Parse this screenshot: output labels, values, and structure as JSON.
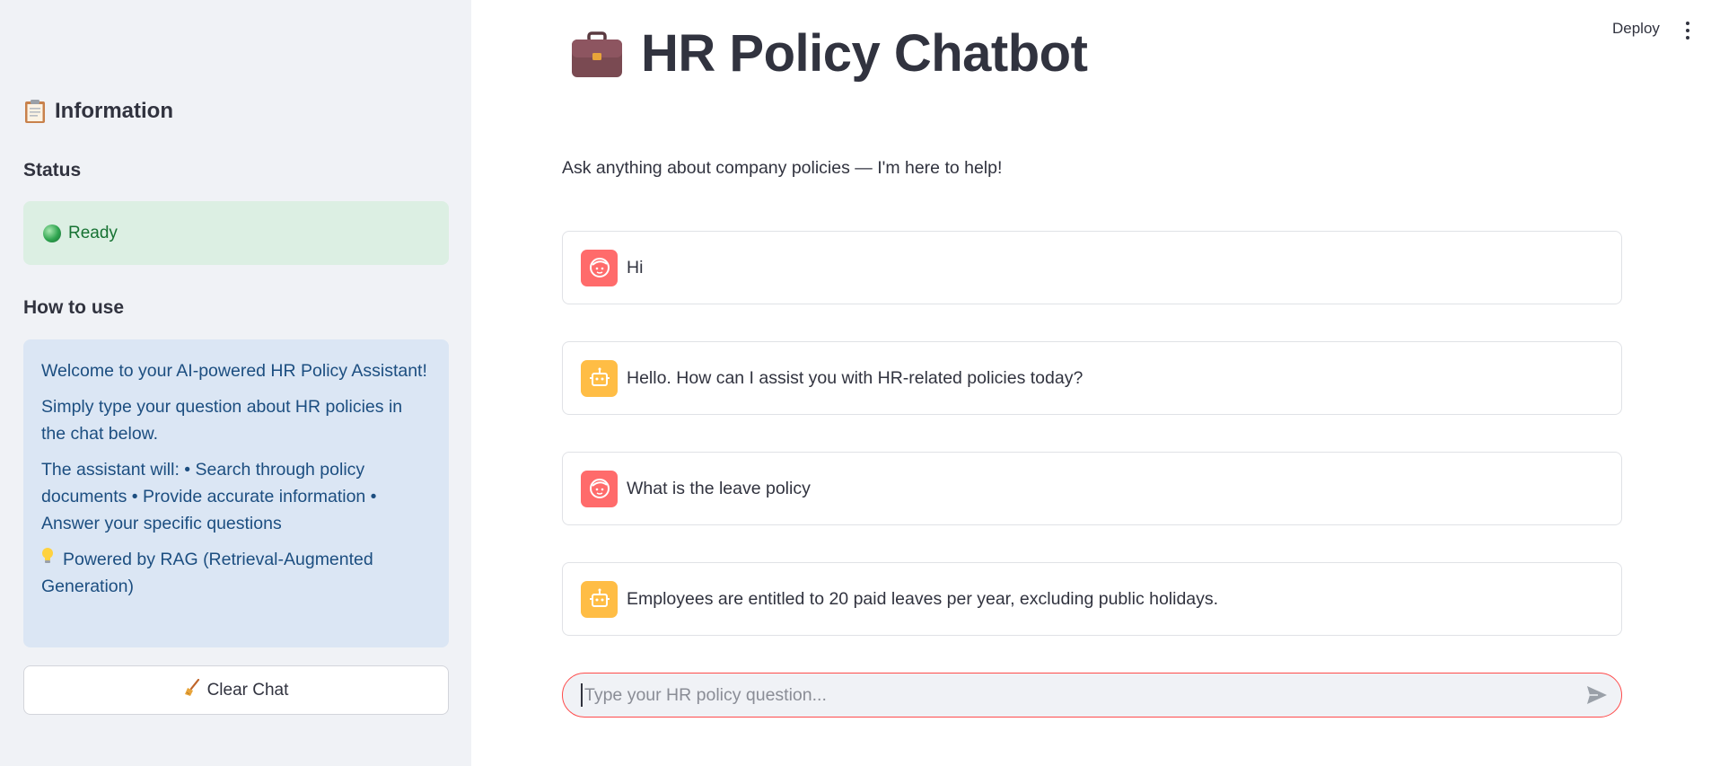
{
  "header": {
    "deploy_label": "Deploy",
    "menu_icon": "kebab-menu-icon"
  },
  "sidebar": {
    "title": "Information",
    "title_icon": "clipboard-icon",
    "status_heading": "Status",
    "status_text": "Ready",
    "status_icon": "green-dot-icon",
    "howto_heading": "How to use",
    "info_paragraphs": [
      "Welcome to your AI-powered HR Policy Assistant!",
      "Simply type your question about HR policies in the chat below.",
      "The assistant will: • Search through policy documents • Provide accurate information • Answer your specific questions",
      "Powered by RAG (Retrieval-Augmented Generation)"
    ],
    "info_last_icon": "lightbulb-icon",
    "clear_button": "Clear Chat",
    "clear_icon": "broom-icon"
  },
  "main": {
    "title": "HR Policy Chatbot",
    "title_icon": "briefcase-icon",
    "subtitle": "Ask anything about company policies — I'm here to help!",
    "messages": [
      {
        "role": "user",
        "text": "Hi"
      },
      {
        "role": "assistant",
        "text": "Hello. How can I assist you with HR-related policies today?"
      },
      {
        "role": "user",
        "text": "What is the leave policy"
      },
      {
        "role": "assistant",
        "text": "Employees are entitled to 20 paid leaves per year, excluding public holidays."
      }
    ],
    "input_placeholder": "Type your HR policy question...",
    "send_icon": "send-icon"
  },
  "colors": {
    "accent": "#ff4b4b",
    "user_avatar": "#ff6b6b",
    "bot_avatar": "#ffbd45",
    "status_bg": "#dcefe3",
    "info_bg": "#dbe6f4",
    "sidebar_bg": "#f0f2f6"
  }
}
